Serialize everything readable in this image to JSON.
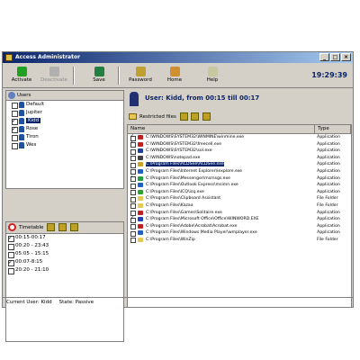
{
  "window": {
    "title": "Access Administrator",
    "buttons": [
      "_",
      "□",
      "×"
    ]
  },
  "toolbar": {
    "items": [
      {
        "label": "Activate",
        "icon": "activate-icon",
        "color": "#20a020",
        "disabled": false
      },
      {
        "label": "Deactivate",
        "icon": "deactivate-icon",
        "color": "#b0b0b0",
        "disabled": true
      },
      {
        "label": "Save",
        "icon": "save-icon",
        "color": "#208040",
        "disabled": false
      },
      {
        "label": "Password",
        "icon": "key-icon",
        "color": "#c0a030",
        "disabled": false
      },
      {
        "label": "Home",
        "icon": "home-icon",
        "color": "#d09030",
        "disabled": false
      },
      {
        "label": "Help",
        "icon": "help-icon",
        "color": "#c8c8a0",
        "disabled": false
      }
    ],
    "clock": "19:29:39"
  },
  "users": {
    "header": "Users",
    "items": [
      {
        "name": "Default",
        "checked": false,
        "selected": false
      },
      {
        "name": "Jupiter",
        "checked": false,
        "selected": false
      },
      {
        "name": "Kidd",
        "checked": true,
        "selected": true
      },
      {
        "name": "Rose",
        "checked": true,
        "selected": false
      },
      {
        "name": "Tiron",
        "checked": false,
        "selected": false
      },
      {
        "name": "Wes",
        "checked": false,
        "selected": false
      }
    ]
  },
  "timetable": {
    "header": "Timetable",
    "items": [
      {
        "text": "00:15-00:17",
        "checked": true
      },
      {
        "text": "00:20 - 23:43",
        "checked": false
      },
      {
        "text": "05:05 - 15:15",
        "checked": false
      },
      {
        "text": "00:07-8:15",
        "checked": true
      },
      {
        "text": "20:20 - 21:10",
        "checked": false
      }
    ]
  },
  "user_header": {
    "title": "User: Kidd, from 00:15 till 00:17"
  },
  "restricted": {
    "label": "Restricted files"
  },
  "table": {
    "columns": [
      "Name",
      "Type"
    ],
    "rows": [
      {
        "name": "C:\\WINDOWS\\SYSTEM32\\WINMINE\\winmine.exe",
        "type": "Application",
        "checked": true,
        "icon": "#c02020",
        "selected": false
      },
      {
        "name": "C:\\WINDOWS\\SYSTEM32\\freecell.exe",
        "type": "Application",
        "checked": true,
        "icon": "#c02020",
        "selected": false
      },
      {
        "name": "C:\\WINDOWS\\SYSTEM32\\sol.exe",
        "type": "Application",
        "checked": false,
        "icon": "#2040a0",
        "selected": false
      },
      {
        "name": "C:\\WINDOWS\\notepad.exe",
        "type": "Application",
        "checked": false,
        "icon": "#404040",
        "selected": false
      },
      {
        "name": "C:\\Program Files\\ACDSee\\ACDSee.exe",
        "type": "Application",
        "checked": false,
        "icon": "#d0a020",
        "selected": true
      },
      {
        "name": "C:\\Program Files\\Internet Explorer\\iexplore.exe",
        "type": "Application",
        "checked": false,
        "icon": "#2060c0",
        "selected": false
      },
      {
        "name": "C:\\Program Files\\Messenger\\msmsgs.exe",
        "type": "Application",
        "checked": true,
        "icon": "#20a040",
        "selected": false
      },
      {
        "name": "C:\\Program Files\\Outlook Express\\msimn.exe",
        "type": "Application",
        "checked": false,
        "icon": "#2060c0",
        "selected": false
      },
      {
        "name": "C:\\Program Files\\ICQ\\icq.exe",
        "type": "Application",
        "checked": false,
        "icon": "#30a030",
        "selected": false
      },
      {
        "name": "C:\\Program Files\\Clipboard Assistant",
        "type": "File Folder",
        "checked": false,
        "icon": "#e8c850",
        "selected": false
      },
      {
        "name": "C:\\Program Files\\Kazaa",
        "type": "File Folder",
        "checked": false,
        "icon": "#e8c850",
        "selected": false
      },
      {
        "name": "C:\\Program Files\\Games\\Solitaire.exe",
        "type": "Application",
        "checked": false,
        "icon": "#c02020",
        "selected": false
      },
      {
        "name": "C:\\Program Files\\Microsoft Office\\Office\\WINWORD.EXE",
        "type": "Application",
        "checked": true,
        "icon": "#2040c0",
        "selected": false
      },
      {
        "name": "C:\\Program Files\\Adobe\\Acrobat\\Acrobat.exe",
        "type": "Application",
        "checked": false,
        "icon": "#c02020",
        "selected": false
      },
      {
        "name": "C:\\Program Files\\Windows Media Player\\wmplayer.exe",
        "type": "Application",
        "checked": false,
        "icon": "#2060c0",
        "selected": false
      },
      {
        "name": "C:\\Program Files\\WinZip",
        "type": "File Folder",
        "checked": false,
        "icon": "#e8c850",
        "selected": false
      }
    ]
  },
  "status": {
    "user": "Current User: Kidd",
    "state": "State: Passive"
  }
}
